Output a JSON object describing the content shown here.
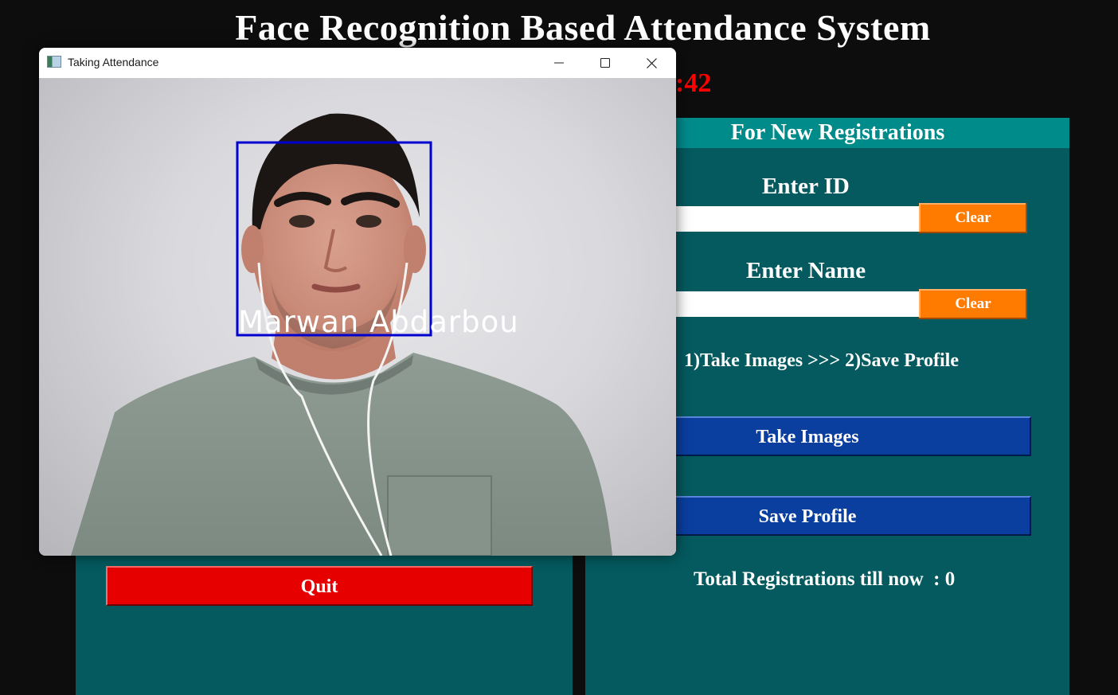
{
  "app": {
    "title": "Face Recognition Based Attendance System",
    "clock_fragment": ":42"
  },
  "registration": {
    "header": "For New Registrations",
    "id_label": "Enter ID",
    "id_value": "",
    "name_label": "Enter Name",
    "name_value": "",
    "clear_label": "Clear",
    "instructions": "1)Take Images >>> 2)Save Profile",
    "take_images_label": "Take Images",
    "save_profile_label": "Save Profile",
    "total_registrations": "Total Registrations till now  : 0"
  },
  "attendance": {
    "quit_label": "Quit"
  },
  "camera_window": {
    "title": "Taking Attendance",
    "recognized_name": "Marwan  Abdarbou",
    "box_color": "#0000d0"
  },
  "colors": {
    "panel": "#045a5f",
    "header": "#008b8b",
    "clear_button": "#ff7b00",
    "action_button": "#0a3fa0",
    "quit_button": "#e60000",
    "clock": "#ff0000"
  }
}
